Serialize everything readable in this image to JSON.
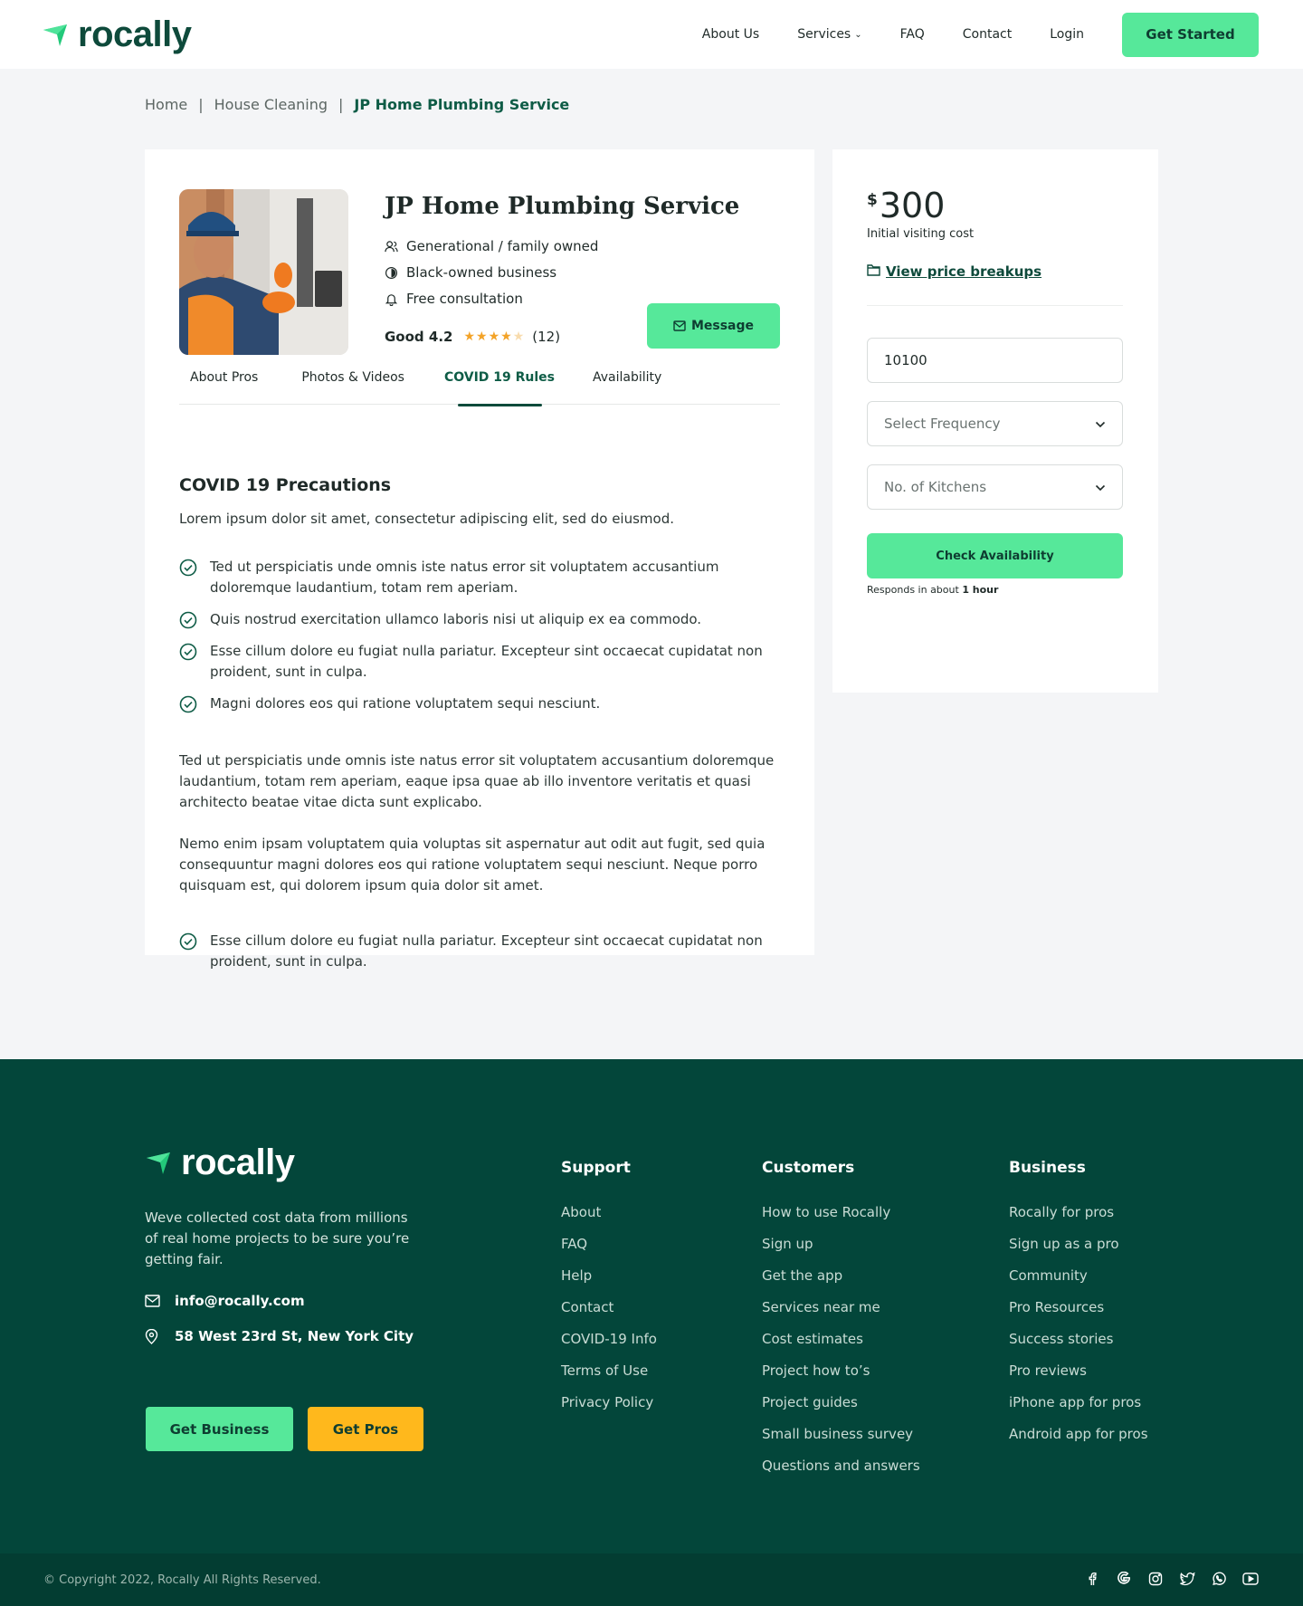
{
  "brand": {
    "name": "rocally",
    "accent": "#56e89a",
    "dark": "#03463a",
    "yellow": "#ffb81c"
  },
  "nav": {
    "items": [
      "About Us",
      "Services",
      "FAQ",
      "Contact",
      "Login"
    ],
    "cta": "Get Started"
  },
  "breadcrumb": [
    "Home",
    "House Cleaning",
    "JP Home Plumbing Service"
  ],
  "breadcrumb_sep": "|",
  "pro": {
    "name": "JP Home Plumbing Service",
    "features": [
      "Generational / family owned",
      "Black-owned business",
      "Free consultation"
    ],
    "rating_label": "Good 4.2",
    "rating_value": 4.2,
    "reviews": "(12)",
    "message_label": "Message"
  },
  "tabs": [
    "About Pros",
    "Photos & Videos",
    "COVID 19 Rules",
    "Availability"
  ],
  "active_tab": "COVID 19 Rules",
  "covid": {
    "title": "COVID 19 Precautions",
    "intro": "Lorem ipsum dolor sit amet, consectetur adipiscing elit, sed do eiusmod.",
    "checklist": [
      "Ted ut perspiciatis unde omnis iste natus error sit voluptatem accusantium doloremque laudantium, totam rem aperiam.",
      "Quis nostrud exercitation ullamco laboris nisi ut aliquip ex ea commodo.",
      "Esse cillum dolore eu fugiat nulla pariatur. Excepteur sint occaecat cupidatat non proident, sunt in culpa.",
      "Magni dolores eos qui ratione voluptatem sequi nesciunt."
    ],
    "para1": "Ted ut perspiciatis unde omnis iste natus error sit voluptatem accusantium doloremque laudantium, totam rem aperiam, eaque ipsa quae ab illo inventore veritatis et quasi architecto beatae vitae dicta sunt explicabo.",
    "para2": "Nemo enim ipsam voluptatem quia voluptas sit aspernatur aut odit aut fugit, sed quia consequuntur magni dolores eos qui ratione voluptatem sequi nesciunt. Neque porro quisquam est, qui dolorem ipsum quia dolor sit amet.",
    "final_check": "Esse cillum dolore eu fugiat nulla pariatur. Excepteur sint occaecat cupidatat non proident, sunt in culpa."
  },
  "booking": {
    "currency": "$",
    "price": "300",
    "price_note": "Initial visiting cost",
    "breakups_label": "View price breakups",
    "zip_value": "10100",
    "frequency_placeholder": "Select Frequency",
    "kitchens_placeholder": "No. of Kitchens",
    "check_label": "Check Availability",
    "responds_prefix": "Responds in about",
    "responds_time": "1 hour"
  },
  "footer": {
    "description": "Weve collected cost data from millions of real home projects to be sure you’re getting fair.",
    "email": "info@rocally.com",
    "address": "58 West 23rd St, New York City",
    "btn_business": "Get Business",
    "btn_pros": "Get Pros",
    "support": {
      "title": "Support",
      "links": [
        "About",
        "FAQ",
        "Help",
        "Contact",
        "COVID-19 Info",
        "Terms of Use",
        "Privacy Policy"
      ]
    },
    "customers": {
      "title": "Customers",
      "links": [
        "How to use Rocally",
        "Sign up",
        "Get the app",
        "Services near me",
        "Cost estimates",
        "Project how to’s",
        "Project guides",
        "Small business survey",
        "Questions and answers"
      ]
    },
    "business": {
      "title": "Business",
      "links": [
        "Rocally for pros",
        "Sign up as a pro",
        "Community",
        "Pro Resources",
        "Success stories",
        "Pro reviews",
        "iPhone app for pros",
        "Android app for pros"
      ]
    },
    "copyright": "© Copyright 2022, Rocally All Rights Reserved.",
    "socials": [
      "facebook-icon",
      "google-icon",
      "instagram-icon",
      "twitter-icon",
      "whatsapp-icon",
      "youtube-icon"
    ]
  }
}
